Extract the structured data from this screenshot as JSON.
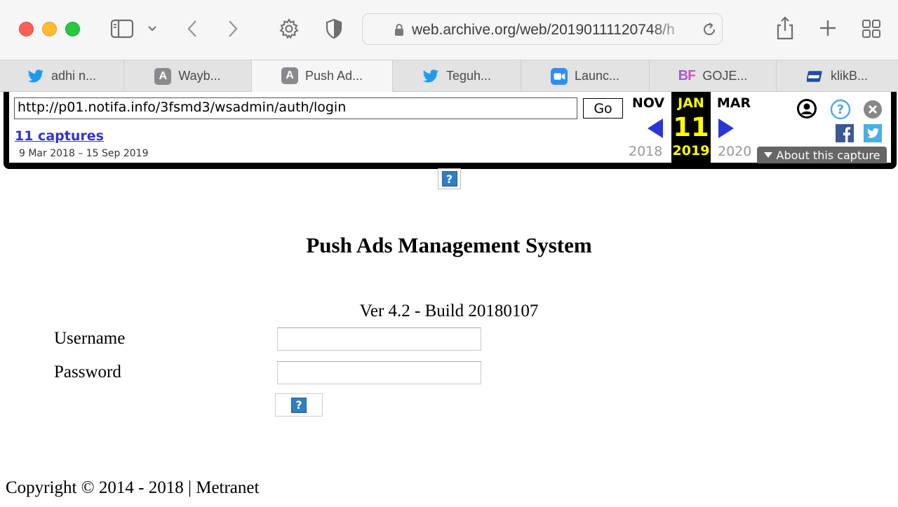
{
  "browser": {
    "address_bar": {
      "url": "web.archive.org/web/20190111120748/h"
    },
    "tabs": [
      {
        "label": "adhi n...",
        "icon": "twitter-icon"
      },
      {
        "label": "Wayb...",
        "icon": "letter-a-icon",
        "letter": "A"
      },
      {
        "label": "Push Ad...",
        "icon": "letter-a-icon",
        "letter": "A",
        "active": true
      },
      {
        "label": "Teguh...",
        "icon": "twitter-icon"
      },
      {
        "label": "Launc...",
        "icon": "zoom-icon"
      },
      {
        "label": "GOJE...",
        "icon": "bf-icon",
        "letter": "BF"
      },
      {
        "label": "klikB...",
        "icon": "klikbca-icon"
      }
    ]
  },
  "wayback": {
    "url": "http://p01.notifa.info/3fsmd3/wsadmin/auth/login",
    "go_label": "Go",
    "captures": "11 captures",
    "range": "9 Mar 2018 – 15 Sep 2019",
    "prev": {
      "month": "NOV",
      "year": "2018"
    },
    "current": {
      "month": "JAN",
      "day": "11",
      "year": "2019"
    },
    "next": {
      "month": "MAR",
      "year": "2020"
    },
    "about": "About this capture",
    "colors": {
      "accent": "#ffff00",
      "arrow": "#2a36d8",
      "link": "#3333cc"
    }
  },
  "page": {
    "title": "Push Ads Management System",
    "version": "Ver 4.2 - Build 20180107",
    "username_label": "Username",
    "username_value": "",
    "password_label": "Password",
    "password_value": "",
    "broken_image_glyph": "?",
    "copyright": "Copyright © 2014 - 2018 | Metranet"
  }
}
